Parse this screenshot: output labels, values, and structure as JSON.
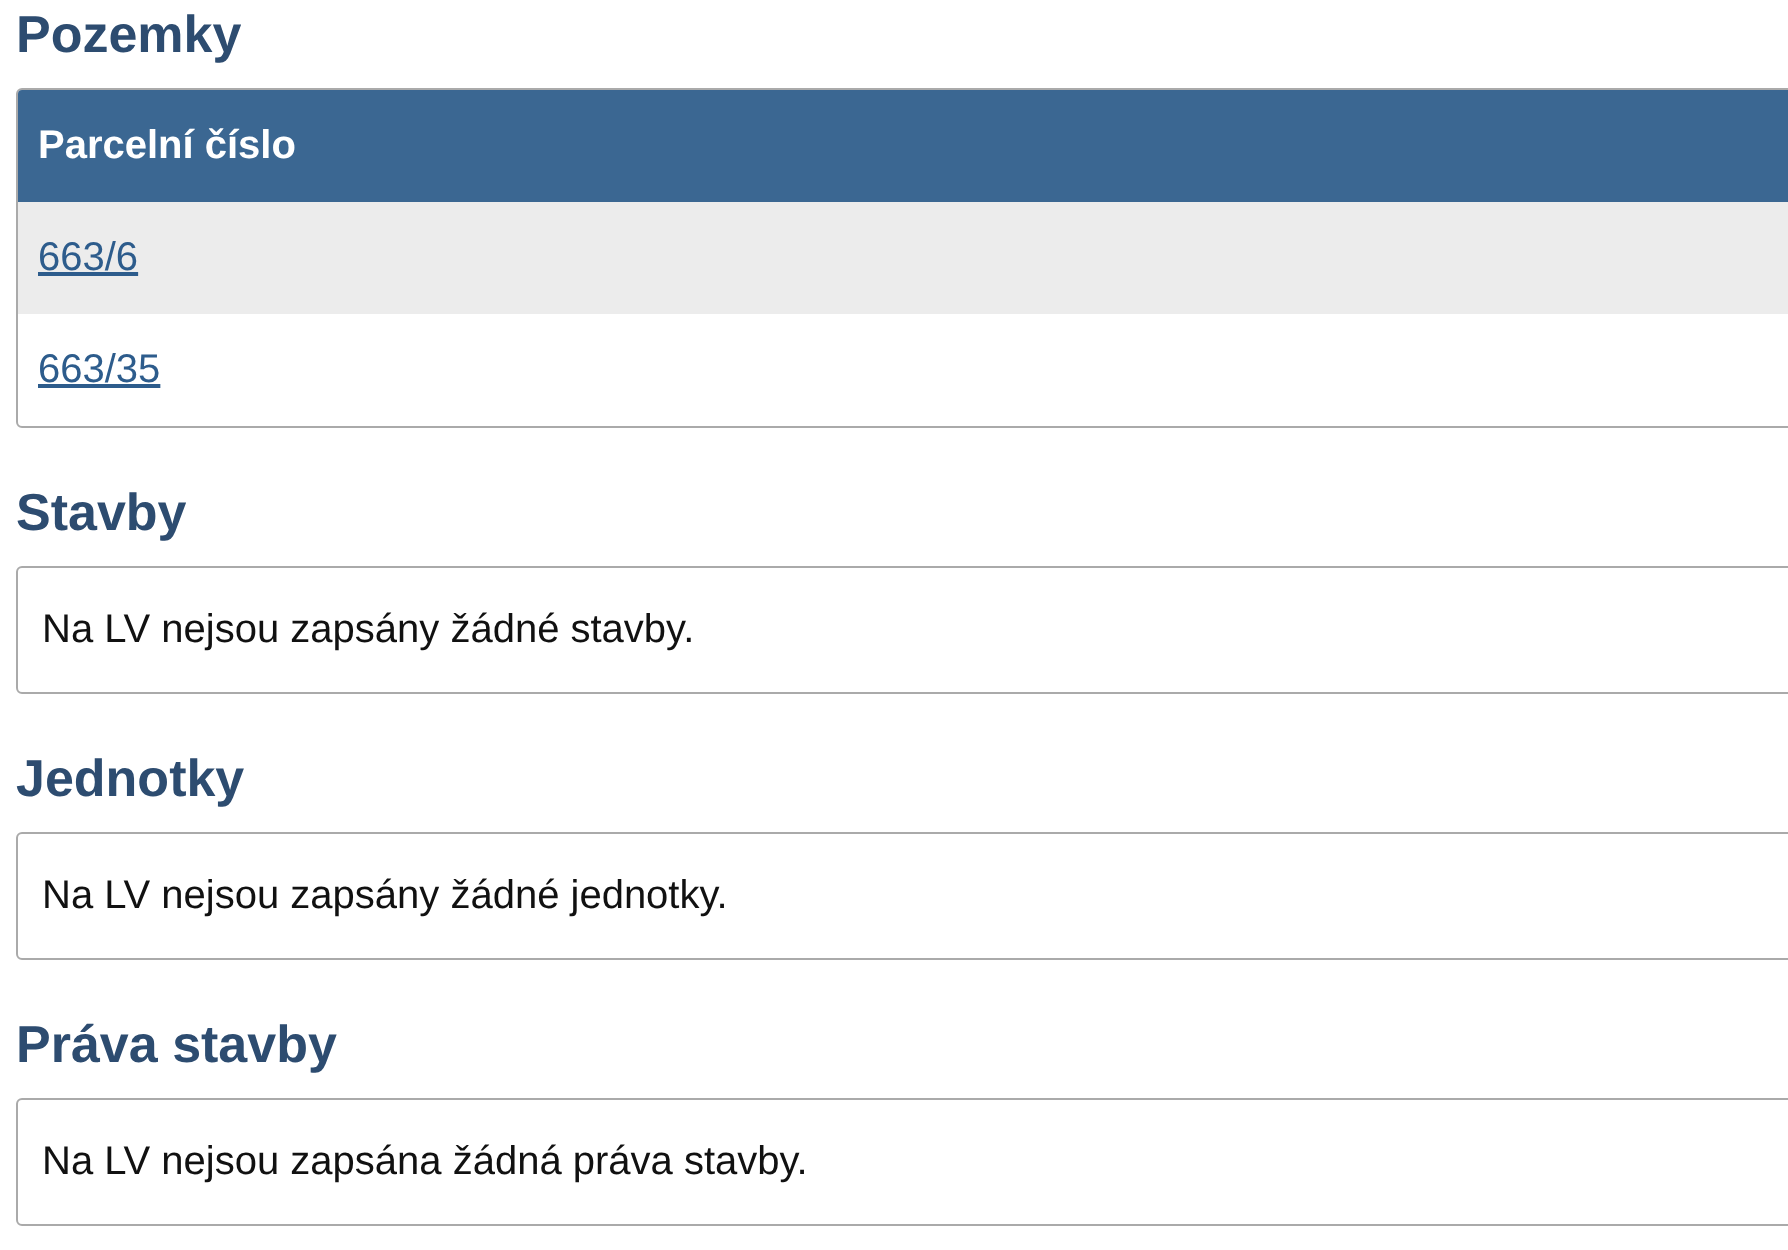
{
  "sections": [
    {
      "title": "Pozemky",
      "kind": "table",
      "column": "Parcelní číslo",
      "rows": [
        {
          "link": "663/6"
        },
        {
          "link": "663/35"
        }
      ]
    },
    {
      "title": "Stavby",
      "kind": "note",
      "text": "Na LV nejsou zapsány žádné stavby."
    },
    {
      "title": "Jednotky",
      "kind": "note",
      "text": "Na LV nejsou zapsány žádné jednotky."
    },
    {
      "title": "Práva stavby",
      "kind": "note",
      "text": "Na LV nejsou zapsána žádná práva stavby."
    }
  ]
}
